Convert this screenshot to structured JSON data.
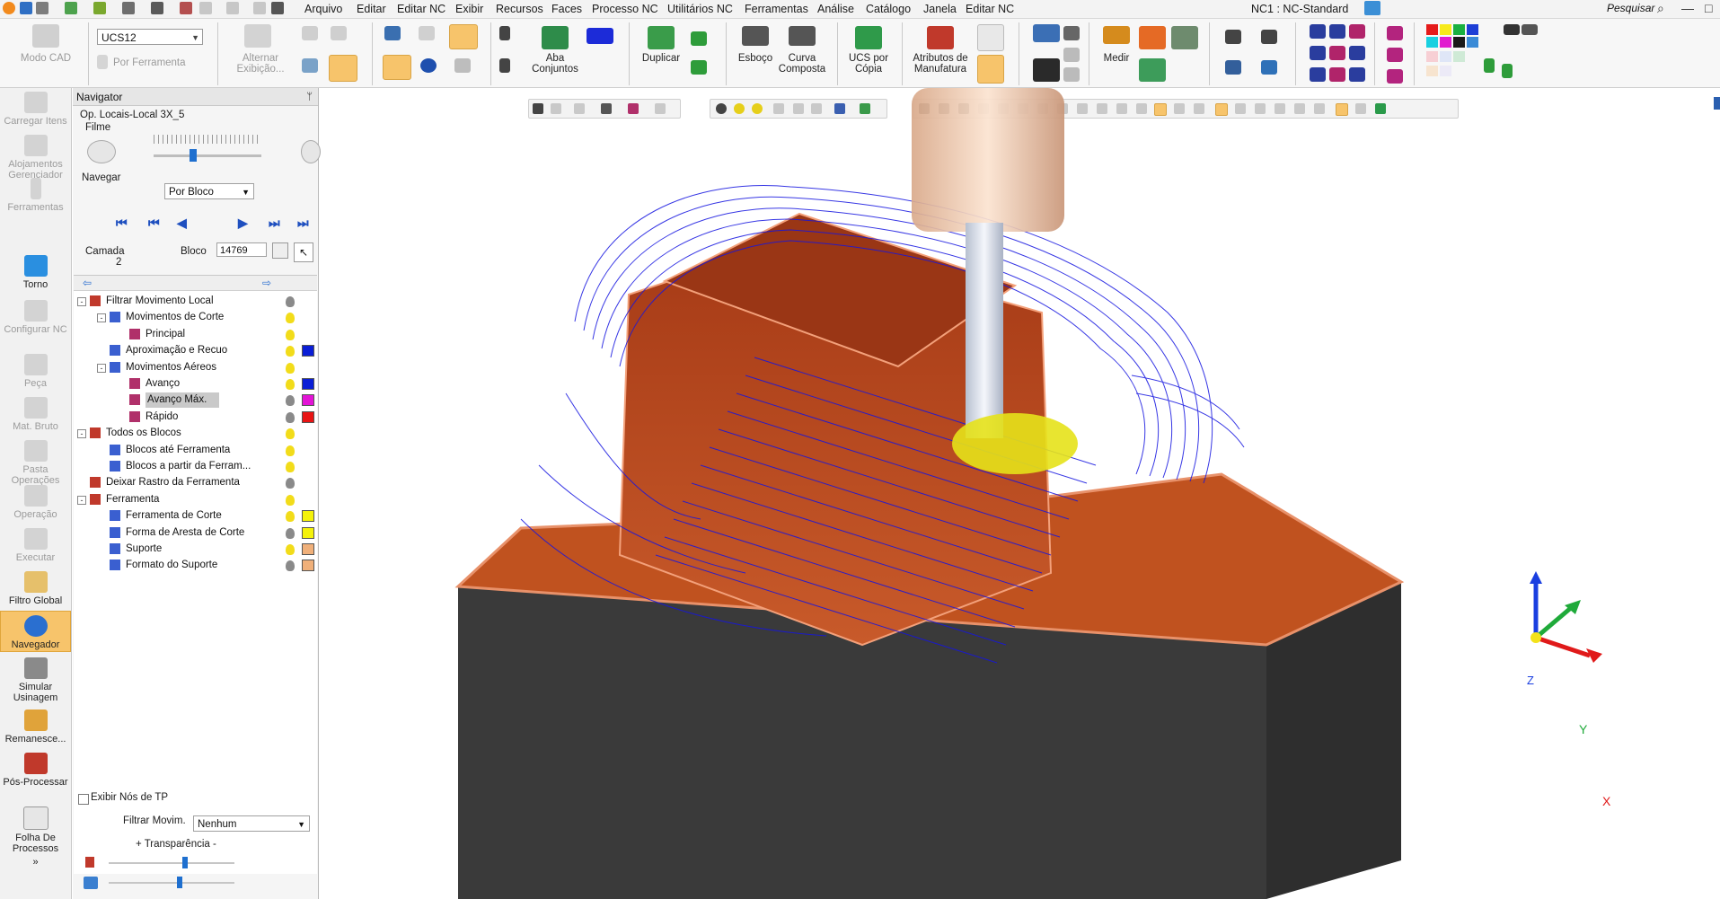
{
  "menubar": {
    "items": [
      "Arquivo",
      "Editar",
      "Editar NC",
      "Exibir",
      "Recursos",
      "Faces",
      "Processo NC",
      "Utilitários NC",
      "Ferramentas",
      "Análise",
      "Catálogo",
      "Janela",
      "Editar NC"
    ],
    "title": "NC1 : NC-Standard",
    "search_label": "Pesquisar",
    "minimize": "—",
    "maximize": "□"
  },
  "ribbon": {
    "modo_cad": "Modo CAD",
    "ucs_value": "UCS12",
    "por_ferramenta": "Por Ferramenta",
    "alternar_exibicao": "Alternar Exibição...",
    "aba_conjuntos": "Aba Conjuntos",
    "duplicar": "Duplicar",
    "esboco": "Esboço",
    "curva_composta": "Curva Composta",
    "ucs_por_copia": "UCS por Cópia",
    "atributos_manufatura": "Atributos de Manufatura",
    "medir": "Medir"
  },
  "left_toolbar": {
    "items": [
      {
        "label": "Carregar Itens",
        "enabled": false
      },
      {
        "label": "Alojamentos Gerenciador",
        "enabled": false
      },
      {
        "label": "Ferramentas",
        "enabled": false
      },
      {
        "label": "Torno",
        "enabled": true
      },
      {
        "label": "Configurar NC",
        "enabled": false
      },
      {
        "label": "Peça",
        "enabled": false
      },
      {
        "label": "Mat. Bruto",
        "enabled": false
      },
      {
        "label": "Pasta Operações",
        "enabled": false
      },
      {
        "label": "Operação",
        "enabled": false
      },
      {
        "label": "Executar",
        "enabled": false
      },
      {
        "label": "Filtro Global",
        "enabled": true
      },
      {
        "label": "Navegador",
        "enabled": true,
        "active": true
      },
      {
        "label": "Simular Usinagem",
        "enabled": true
      },
      {
        "label": "Remanesce...",
        "enabled": true
      },
      {
        "label": "Pós-Processar",
        "enabled": true
      },
      {
        "label": "Folha De Processos",
        "enabled": true
      }
    ]
  },
  "navigator": {
    "title": "Navigator",
    "pin": "ᛘ",
    "operation": "Op. Locais-Local 3X_5",
    "filme_label": "Filme",
    "navegar_label": "Navegar",
    "navegar_select": "Por Bloco",
    "camada_label": "Camada",
    "camada_value": "2",
    "bloco_label": "Bloco",
    "bloco_value": "14769",
    "tree": [
      {
        "label": "Filtrar Movimento Local",
        "level": 0,
        "expander": "-",
        "bulb": false,
        "swatch": null
      },
      {
        "label": "Movimentos de Corte",
        "level": 1,
        "expander": "-",
        "bulb": true,
        "swatch": null
      },
      {
        "label": "Principal",
        "level": 2,
        "expander": null,
        "bulb": true,
        "swatch": null
      },
      {
        "label": "Aproximação e Recuo",
        "level": 1,
        "expander": null,
        "bulb": true,
        "swatch": "#0a1ed6"
      },
      {
        "label": "Movimentos Aéreos",
        "level": 1,
        "expander": "-",
        "bulb": true,
        "swatch": null
      },
      {
        "label": "Avanço",
        "level": 2,
        "expander": null,
        "bulb": true,
        "swatch": "#0a1ed6"
      },
      {
        "label": "Avanço Máx.",
        "level": 2,
        "expander": null,
        "bulb": false,
        "swatch": "#e313d6",
        "selected": true
      },
      {
        "label": "Rápido",
        "level": 2,
        "expander": null,
        "bulb": false,
        "swatch": "#e81414"
      },
      {
        "label": "Todos os Blocos",
        "level": 0,
        "expander": "-",
        "bulb": true,
        "swatch": null
      },
      {
        "label": "Blocos até Ferramenta",
        "level": 1,
        "expander": null,
        "bulb": true,
        "swatch": null
      },
      {
        "label": "Blocos a partir da Ferram...",
        "level": 1,
        "expander": null,
        "bulb": true,
        "swatch": null
      },
      {
        "label": "Deixar Rastro da Ferramenta",
        "level": 0,
        "expander": null,
        "bulb": false,
        "swatch": null
      },
      {
        "label": "Ferramenta",
        "level": 0,
        "expander": "-",
        "bulb": true,
        "swatch": null
      },
      {
        "label": "Ferramenta de Corte",
        "level": 1,
        "expander": null,
        "bulb": true,
        "swatch": "#f4f20a"
      },
      {
        "label": "Forma de Aresta de Corte",
        "level": 1,
        "expander": null,
        "bulb": false,
        "swatch": "#f4f20a"
      },
      {
        "label": "Suporte",
        "level": 1,
        "expander": null,
        "bulb": true,
        "swatch": "#f0b07a"
      },
      {
        "label": "Formato do Suporte",
        "level": 1,
        "expander": null,
        "bulb": false,
        "swatch": "#f0b07a"
      }
    ],
    "exibir_nos": "Exibir Nós de TP",
    "filtrar_movim_label": "Filtrar Movim.",
    "filtrar_movim_value": "Nenhum",
    "transparencia": "+ Transparência -"
  },
  "viewport": {
    "axis_x": "X",
    "axis_y": "Y",
    "axis_z": "Z",
    "colors": {
      "part_top": "#b84a1e",
      "part_side": "#3d3d3d",
      "toolpath": "#1515e0",
      "tool": "#f3c9a8",
      "contact": "#e6e21a"
    }
  }
}
